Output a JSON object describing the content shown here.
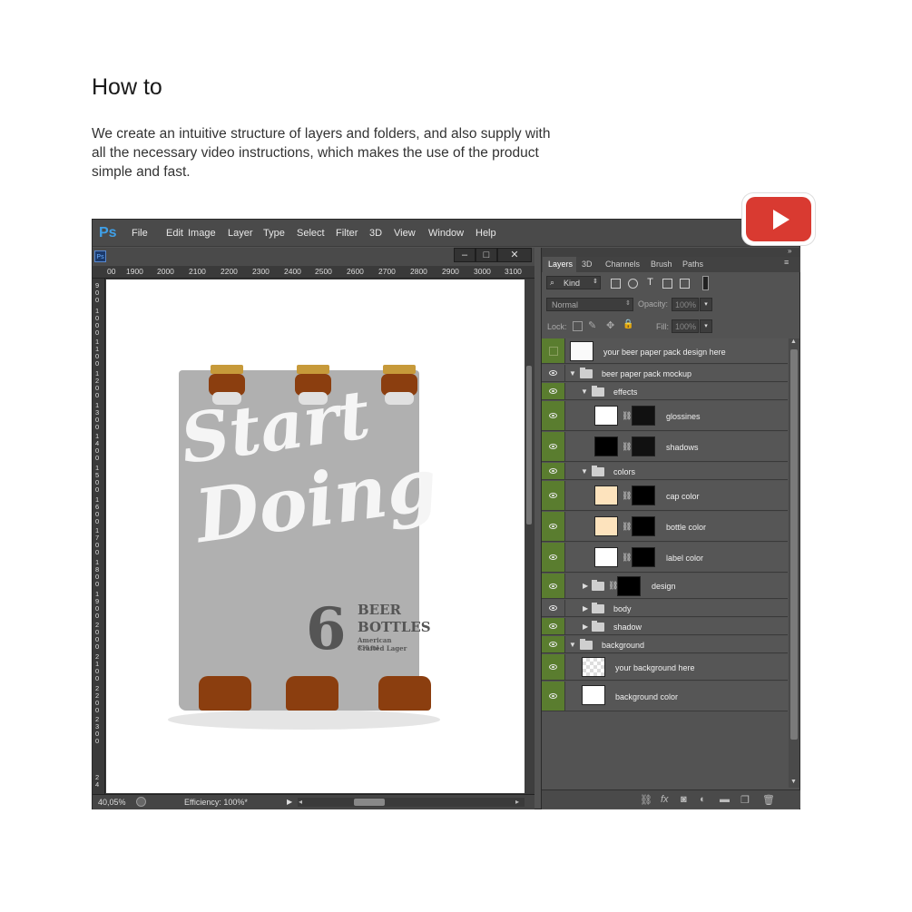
{
  "page": {
    "heading": "How to",
    "intro_lines": [
      "We create an intuitive structure of layers and folders, and also supply with",
      "all the necessary video instructions, which makes the use of the product",
      "simple and fast."
    ]
  },
  "app": {
    "logo": "Ps",
    "menu": [
      "File",
      "Edit",
      "Image",
      "Layer",
      "Type",
      "Select",
      "Filter",
      "3D",
      "View",
      "Window",
      "Help"
    ],
    "doc_icon": "Ps",
    "window_buttons": [
      "minimize-icon",
      "maximize-icon",
      "close-icon"
    ],
    "ruler_h": [
      "00",
      "1900",
      "2000",
      "2100",
      "2200",
      "2300",
      "2400",
      "2500",
      "2600",
      "2700",
      "2800",
      "2900",
      "3000",
      "3100"
    ],
    "ruler_v": [
      "900",
      "1000",
      "1100",
      "1200",
      "1300",
      "1400",
      "1500",
      "1600",
      "1700",
      "1800",
      "1900",
      "2000",
      "2100",
      "2200",
      "2300",
      "24"
    ],
    "status": {
      "zoom": "40,05%",
      "efficiency": "Efficiency: 100%*"
    }
  },
  "artwork": {
    "script_line1": "Start",
    "script_line2": "Doing",
    "count": "6",
    "line1": "BEER",
    "line2": "BOTTLES",
    "line3": "American Crafted Lager",
    "line4": "330 ml"
  },
  "panels": {
    "tabs": [
      "Layers",
      "3D",
      "Channels",
      "Brush",
      "Paths"
    ],
    "filter_kind": "Kind",
    "blend_mode": "Normal",
    "opacity_label": "Opacity:",
    "opacity_value": "100%",
    "lock_label": "Lock:",
    "fill_label": "Fill:",
    "fill_value": "100%",
    "layers": [
      {
        "name": "your beer paper pack design here"
      },
      {
        "name": "beer paper pack mockup"
      },
      {
        "name": "effects"
      },
      {
        "name": "glossines"
      },
      {
        "name": "shadows"
      },
      {
        "name": "colors"
      },
      {
        "name": "cap color"
      },
      {
        "name": "bottle color"
      },
      {
        "name": "label color"
      },
      {
        "name": "design"
      },
      {
        "name": "body"
      },
      {
        "name": "shadow"
      },
      {
        "name": "background"
      },
      {
        "name": "your background here"
      },
      {
        "name": "background color"
      }
    ]
  },
  "colors": {
    "accent_green": "#5a7d2f",
    "youtube_red": "#d93a31",
    "ps_blue": "#3fa0e8"
  }
}
